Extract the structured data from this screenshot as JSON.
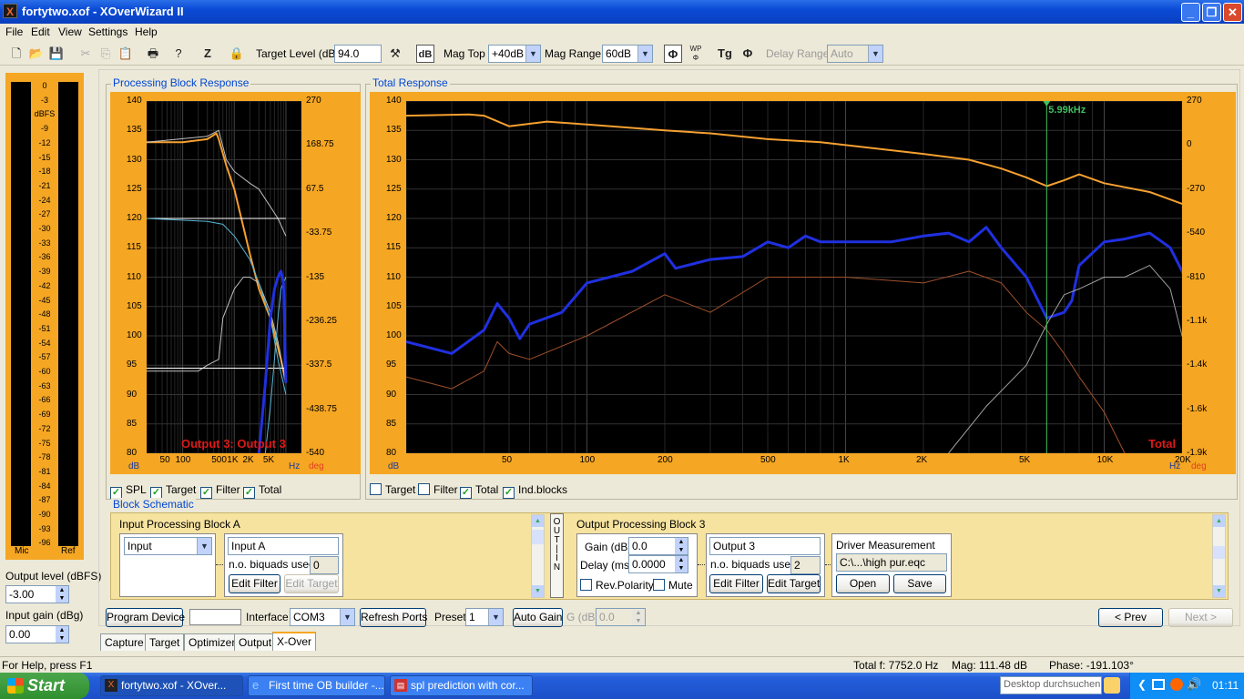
{
  "window": {
    "title": "fortytwo.xof - XOverWizard II",
    "icon": "xo-app-icon"
  },
  "menu": [
    "File",
    "Edit",
    "View",
    "Settings",
    "Help"
  ],
  "toolbar": {
    "target_level_label": "Target Level (dB)",
    "target_level_value": "94.0",
    "db_label": "dB",
    "mag_top_label": "Mag Top",
    "mag_top_value": "+40dB",
    "mag_range_label": "Mag Range",
    "mag_range_value": "60dB",
    "delay_range_label": "Delay Range",
    "delay_range_value": "Auto",
    "wp_label": "WP",
    "tg_label": "Tg"
  },
  "meter": {
    "scale": [
      "0",
      "-3",
      "dBFS",
      "-9",
      "-12",
      "-15",
      "-18",
      "-21",
      "-24",
      "-27",
      "-30",
      "-33",
      "-36",
      "-39",
      "-42",
      "-45",
      "-48",
      "-51",
      "-54",
      "-57",
      "-60",
      "-63",
      "-66",
      "-69",
      "-72",
      "-75",
      "-78",
      "-81",
      "-84",
      "-87",
      "-90",
      "-93",
      "-96"
    ],
    "left_label": "Mic",
    "right_label": "Ref",
    "output_level_label": "Output level (dBFS)",
    "output_level_value": "-3.00",
    "input_gain_label": "Input gain (dBg)",
    "input_gain_value": "0.00"
  },
  "block_panel": {
    "title": "Processing Block Response",
    "overlay_label": "Output 3: Output 3",
    "y_left_unit": "dB",
    "y_right_unit": "deg",
    "x_unit": "Hz",
    "checks": [
      {
        "label": "SPL",
        "checked": true
      },
      {
        "label": "Target",
        "checked": true
      },
      {
        "label": "Filter",
        "checked": true
      },
      {
        "label": "Total",
        "checked": true
      }
    ]
  },
  "total_panel": {
    "title": "Total Response",
    "cursor_label": "5.99kHz",
    "overlay_label": "Total",
    "y_left_unit": "dB",
    "y_right_unit": "deg",
    "x_unit": "Hz",
    "checks": [
      {
        "label": "Target",
        "checked": false
      },
      {
        "label": "Filter",
        "checked": false
      },
      {
        "label": "Total",
        "checked": true
      },
      {
        "label": "Ind.blocks",
        "checked": true
      }
    ]
  },
  "chart_data": [
    {
      "type": "line",
      "title": "Processing Block Response",
      "xscale": "log",
      "xlim": [
        20,
        20000
      ],
      "ylim": [
        80,
        140
      ],
      "y2lim": [
        -540,
        270
      ],
      "x_ticks": [
        "50",
        "100",
        "500",
        "1K",
        "2K",
        "5K"
      ],
      "y_ticks": [
        "140",
        "135",
        "130",
        "125",
        "120",
        "115",
        "110",
        "105",
        "100",
        "95",
        "90",
        "85",
        "80"
      ],
      "y2_ticks": [
        "270",
        "168.75",
        "67.5",
        "-33.75",
        "-135",
        "-236.25",
        "-337.5",
        "-438.75",
        "-540"
      ],
      "series": [
        {
          "color": "#f5a030",
          "x": [
            20,
            100,
            300,
            450,
            500,
            700,
            1000,
            2000,
            3000,
            5000,
            8000,
            10000
          ],
          "y": [
            133,
            133,
            133.5,
            134.5,
            133.5,
            129,
            125,
            114,
            108,
            103,
            96,
            92
          ]
        },
        {
          "color": "#c0c0c0",
          "x": [
            20,
            300,
            500,
            700,
            1000,
            2000,
            3000,
            5000,
            7000,
            10000
          ],
          "y": [
            133,
            134,
            135,
            130,
            128,
            126,
            125,
            122,
            120,
            117
          ]
        },
        {
          "color": "#c0c0c0",
          "x": [
            20,
            200,
            300,
            500,
            600,
            1000,
            1500,
            2000,
            3000,
            5000,
            7000,
            10000
          ],
          "y": [
            94,
            94,
            95,
            96,
            103,
            108,
            110,
            110,
            109,
            104,
            99,
            92
          ]
        },
        {
          "color": "#ffffff",
          "x": [
            20,
            10000
          ],
          "y": [
            120,
            120
          ]
        },
        {
          "color": "#ffffff",
          "x": [
            20,
            10000
          ],
          "y": [
            94.5,
            94.5
          ]
        },
        {
          "color": "#58b8d8",
          "x": [
            20,
            300,
            600,
            1000,
            2000,
            3000,
            5000,
            7000,
            10000
          ],
          "y": [
            120,
            119.5,
            119,
            117,
            113,
            109,
            103,
            96,
            90
          ]
        },
        {
          "color": "#58b8d8",
          "x": [
            4000,
            5000,
            6000,
            7000,
            8000,
            10000
          ],
          "y": [
            80,
            88,
            96,
            103,
            108,
            110
          ]
        },
        {
          "color": "#2030e0",
          "x": [
            3000,
            4000,
            5000,
            6000,
            7000,
            8000,
            9000,
            10000
          ],
          "y": [
            80,
            92,
            103,
            108,
            110,
            111,
            109,
            92
          ]
        }
      ]
    },
    {
      "type": "line",
      "title": "Total Response",
      "xscale": "log",
      "xlim": [
        20,
        20000
      ],
      "ylim": [
        80,
        140
      ],
      "y2lim": [
        -1900,
        270
      ],
      "x_ticks": [
        "50",
        "100",
        "200",
        "500",
        "1K",
        "2K",
        "5K",
        "10K",
        "20K"
      ],
      "y_ticks": [
        "140",
        "135",
        "130",
        "125",
        "120",
        "115",
        "110",
        "105",
        "100",
        "95",
        "90",
        "85",
        "80"
      ],
      "y2_ticks": [
        "270",
        "0",
        "-270",
        "-540",
        "-810",
        "-1.1k",
        "-1.4k",
        "-1.6k",
        "-1.9k"
      ],
      "series": [
        {
          "color": "#f5a030",
          "x": [
            20,
            35,
            40,
            50,
            70,
            100,
            200,
            300,
            500,
            800,
            1000,
            2000,
            3000,
            4000,
            5000,
            6000,
            7000,
            8000,
            10000,
            15000,
            20000,
            40000
          ],
          "y": [
            137.5,
            137.7,
            137.5,
            135.7,
            136.5,
            136,
            135,
            134.5,
            133.5,
            133,
            132.5,
            131,
            130,
            128.5,
            127,
            125.5,
            126.5,
            127.5,
            126,
            124.5,
            122.5,
            123.5
          ]
        },
        {
          "color": "#2030e0",
          "x": [
            20,
            30,
            40,
            45,
            50,
            55,
            60,
            80,
            100,
            150,
            200,
            220,
            300,
            400,
            500,
            600,
            700,
            800,
            1000,
            1500,
            2000,
            2500,
            3000,
            3500,
            4000,
            5000,
            6000,
            7000,
            7500,
            8000,
            10000,
            12000,
            15000,
            18000,
            20000,
            25000,
            30000,
            40000
          ],
          "y": [
            99,
            97,
            101,
            105.5,
            103,
            99.5,
            102,
            104,
            109,
            111,
            114,
            111.5,
            113,
            113.5,
            116,
            115,
            117,
            116,
            116,
            116,
            117,
            117.5,
            116,
            118.5,
            115,
            110,
            103,
            104,
            106,
            112,
            116,
            116.5,
            117.5,
            115,
            111,
            100,
            92,
            79
          ]
        },
        {
          "color": "#a0502a",
          "x": [
            20,
            30,
            40,
            45,
            50,
            60,
            100,
            200,
            300,
            500,
            1000,
            2000,
            3000,
            4000,
            5000,
            6000,
            7000,
            8000,
            10000,
            12000
          ],
          "y": [
            93,
            91,
            94,
            99,
            97,
            96,
            100,
            107,
            104,
            110,
            110,
            109,
            111,
            109,
            104,
            101,
            97,
            93,
            87,
            80
          ]
        },
        {
          "color": "#a0a0a0",
          "x": [
            2500,
            3500,
            5000,
            6000,
            7000,
            8000,
            10000,
            12000,
            15000,
            18000,
            20000,
            25000
          ],
          "y": [
            80,
            88,
            95,
            102,
            107,
            108,
            110,
            110,
            112,
            108,
            100,
            95
          ]
        }
      ]
    }
  ],
  "schematic": {
    "title": "Block Schematic",
    "in_out_label": "OUT IN",
    "input_block": {
      "title": "Input Processing Block A",
      "source_value": "Input",
      "name_value": "Input A",
      "biquads_label": "n.o. biquads used",
      "biquads_value": "0",
      "edit_filter": "Edit Filter",
      "edit_target": "Edit Target"
    },
    "output_block": {
      "title": "Output Processing Block 3",
      "gain_label": "Gain (dB)",
      "gain_value": "0.0",
      "delay_label": "Delay (ms)",
      "delay_value": "0.0000",
      "rev_polarity": "Rev.Polarity",
      "mute": "Mute",
      "name_value": "Output 3",
      "biquads_label": "n.o. biquads used",
      "biquads_value": "2",
      "edit_filter": "Edit Filter",
      "edit_target": "Edit Target",
      "driver_title": "Driver Measurement",
      "driver_file": "C:\\...\\high pur.eqc",
      "open": "Open",
      "save": "Save"
    }
  },
  "bottom_bar": {
    "program_device": "Program Device",
    "interface_label": "Interface",
    "interface_value": "COM3",
    "refresh_ports": "Refresh Ports",
    "preset_label": "Preset",
    "preset_value": "1",
    "auto_gain": "Auto Gain",
    "g_label": "G (dB)",
    "g_value": "0.0",
    "prev": "< Prev",
    "next": "Next >"
  },
  "tabs": [
    "Capture",
    "Target",
    "Optimizer",
    "Output",
    "X-Over"
  ],
  "active_tab": "X-Over",
  "status": {
    "help": "For Help, press F1",
    "total_f": "Total f: 7752.0 Hz",
    "mag": "Mag: 111.48 dB",
    "phase": "Phase: -191.103°"
  },
  "taskbar": {
    "start": "Start",
    "tasks": [
      "fortytwo.xof - XOver...",
      "First time OB builder -...",
      "spl prediction with cor..."
    ],
    "search_placeholder": "Desktop durchsuchen",
    "clock": "01:11"
  },
  "colors": {
    "plot_frame": "#f5a623",
    "accent_title": "#0046d5",
    "overlay_red": "#e01818",
    "cursor_green": "#3fbf5f"
  }
}
